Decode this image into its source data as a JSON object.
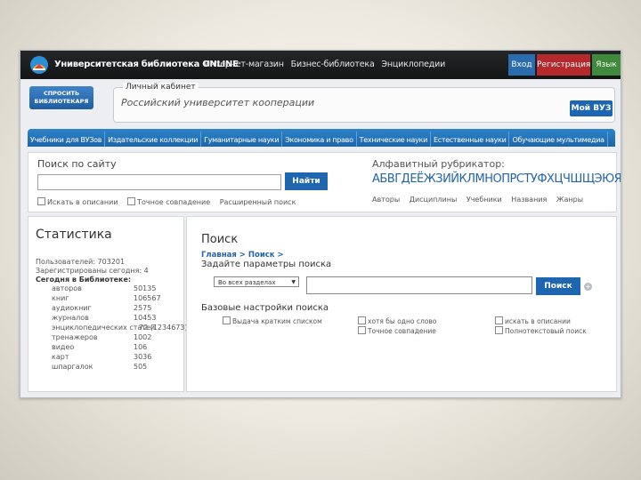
{
  "topbar": {
    "site_title": "Университетская библиотека ONLINE",
    "nav": [
      "Интернет-магазин",
      "Бизнес-библиотека",
      "Энциклопедии"
    ],
    "login": "Вход",
    "register": "Регистрация",
    "language": "Язык"
  },
  "ask_librarian": [
    "СПРОСИТЬ",
    "БИБЛИОТЕКАРЯ"
  ],
  "cabinet": {
    "title": "Личный кабинет",
    "university": "Российский университет кооперации",
    "my_vuz": "Мой ВУЗ"
  },
  "menu": [
    "Учебники для ВУЗов",
    "Издательские коллекции",
    "Гуманитарные науки",
    "Экономика и право",
    "Технические науки",
    "Естественные науки",
    "Обучающие мультимедиа"
  ],
  "site_search": {
    "title": "Поиск по сайту",
    "button": "Найти",
    "options": [
      "Искать в описании",
      "Точное совпадение",
      "Расширенный поиск"
    ]
  },
  "alphabet_index": {
    "title": "Алфавитный рубрикатор:",
    "letters": "АБВГДЕЁЖЗИЙКЛМНОПРСТУФХЦЧШЩЭЮЯ",
    "links": [
      "Авторы",
      "Дисциплины",
      "Учебники",
      "Названия",
      "Жанры"
    ]
  },
  "stats": {
    "title": "Статистика",
    "users": "Пользователей: 703201",
    "registered_today": "Зарегистрированы сегодня: 4",
    "today": "Сегодня в Библиотеке:",
    "rows": [
      {
        "k": "авторов",
        "v": "50135"
      },
      {
        "k": "книг",
        "v": "106567"
      },
      {
        "k": "аудиокниг",
        "v": "2575"
      },
      {
        "k": "журналов",
        "v": "10453"
      },
      {
        "k": "энциклопедических статей",
        "v": "72 (1234673)"
      },
      {
        "k": "тренажеров",
        "v": "1002"
      },
      {
        "k": "видео",
        "v": "106"
      },
      {
        "k": "карт",
        "v": "3036"
      },
      {
        "k": "шпаргалок",
        "v": "505"
      }
    ]
  },
  "search_page": {
    "title": "Поиск",
    "breadcrumb": "Главная > Поиск >",
    "hint": "Задайте параметры поиска",
    "scope": "Во всех разделах",
    "button": "Поиск",
    "plus": "+",
    "basic_settings": "Базовые настройки поиска",
    "options": [
      "Выдача кратким списком",
      "хотя бы одно слово",
      "искать в описании",
      "Точное совпадение",
      "Полнотекстовый поиск"
    ]
  }
}
